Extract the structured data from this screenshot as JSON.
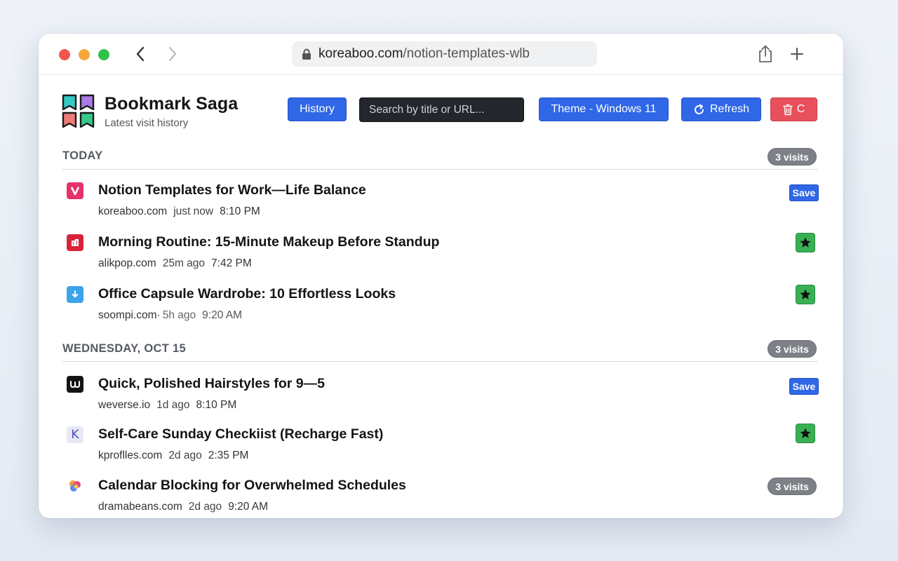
{
  "browser": {
    "url_host": "koreaboo.com",
    "url_path": "/notion-templates-wlb"
  },
  "app": {
    "title": "Bookmark Saga",
    "subtitle": "Latest visit history"
  },
  "toolbar": {
    "history_label": "History",
    "search_placeholder": "Search by title or URL...",
    "theme_label": "Theme - Windows 11",
    "refresh_label": "Refresh",
    "clear_label": "C"
  },
  "sections": [
    {
      "title": "TODAY",
      "badge": "3 visits",
      "items": [
        {
          "title": "Notion Templates for Work—Life Balance",
          "domain": "koreaboo.com",
          "ago": "just now",
          "time": "8:10 PM",
          "action": "Save",
          "icon": "v-letter-icon"
        },
        {
          "title": "Morning Routine: 15-Minute Makeup Before Standup",
          "domain": "alikpop.com",
          "ago": "25m ago",
          "time": "7:42 PM",
          "action": "star",
          "icon": "allkpop-icon"
        },
        {
          "title": "Office Capsule Wardrobe: 10 Effortless Looks",
          "domain": "soompi.com·",
          "ago": "5h ago",
          "time": "9:20 AM",
          "action": "star",
          "icon": "download-arrow-icon"
        }
      ]
    },
    {
      "title": "WEDNESDAY, OCT 15",
      "badge": "3 visits",
      "items": [
        {
          "title": "Quick, Polished Hairstyles for 9—5",
          "domain": "weverse.io",
          "ago": "1d ago",
          "time": "8:10 PM",
          "action": "Save",
          "icon": "weverse-icon"
        },
        {
          "title": "Self-Care Sunday Checkiist (Recharge Fast)",
          "domain": "kproflles.com",
          "ago": "2d ago",
          "time": "2:35 PM",
          "action": "star",
          "icon": "k-letter-icon"
        },
        {
          "title": "Calendar Blocking for Overwhelmed Schedules",
          "domain": "dramabeans.com",
          "ago": "2d ago",
          "time": "9:20 AM",
          "action": "3 visits",
          "icon": "dramabeans-icon"
        }
      ]
    }
  ],
  "colors": {
    "accent_blue": "#2f67e6",
    "danger_red": "#e8505b",
    "star_green": "#39b054",
    "badge_gray": "#7d8086"
  }
}
